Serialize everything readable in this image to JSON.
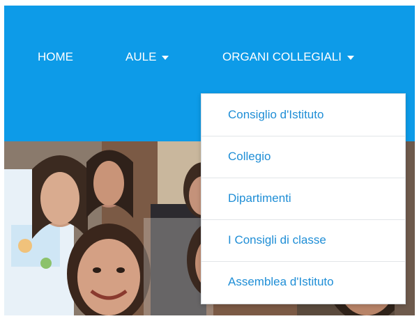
{
  "nav": {
    "items": [
      {
        "label": "HOME",
        "has_caret": false
      },
      {
        "label": "AULE",
        "has_caret": true
      },
      {
        "label": "ORGANI COLLEGIALI",
        "has_caret": true
      }
    ]
  },
  "dropdown": {
    "items": [
      {
        "label": "Consiglio d'Istituto"
      },
      {
        "label": "Collegio"
      },
      {
        "label": "Dipartimenti"
      },
      {
        "label": "I Consigli di classe"
      },
      {
        "label": "Assemblea d'Istituto"
      }
    ]
  },
  "colors": {
    "navbar": "#0d9be8",
    "nav_text": "#ffffff",
    "dropdown_text": "#1f8ed6",
    "dropdown_bg": "#ffffff"
  },
  "hero": {
    "kind": "photo"
  }
}
